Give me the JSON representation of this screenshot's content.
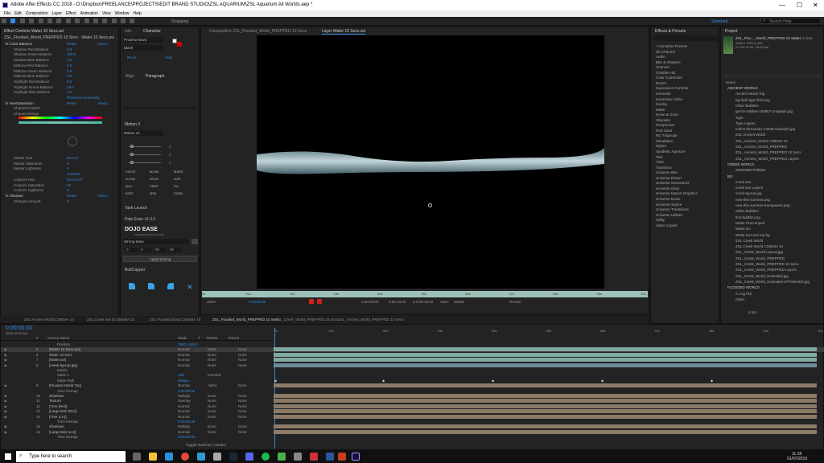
{
  "window": {
    "title": "Adobe After Effects CC 2018 - D:\\Dropbox\\FREELANCE\\PROJECTS\\EDIT BRAND STUDIO\\ZSL AQUARIUM\\ZSL Aquarium All Worlds.aep *",
    "minimize": "—",
    "maximize": "☐",
    "close": "✕"
  },
  "menu": [
    "File",
    "Edit",
    "Composition",
    "Layer",
    "Effect",
    "Animation",
    "View",
    "Window",
    "Help"
  ],
  "toolbar": {
    "snapping": "Snapping",
    "workspace": "Standard",
    "search": "Search Help"
  },
  "effect_controls": {
    "tab": "Effect Controls Water 10 Secs.avi",
    "sub": "ZSL_Flooded_World_PREPPED 10 Secs · Water 10 Secs.avi",
    "rows": [
      {
        "l": "fx Color Balance",
        "v": "Reset",
        "v2": "About..."
      },
      {
        "l": "Shadow Red Balance",
        "v": "0.0"
      },
      {
        "l": "Shadow Green Balance",
        "v": "100.0"
      },
      {
        "l": "Shadow Blue Balance",
        "v": "0.0"
      },
      {
        "l": "Midtone Red Balance",
        "v": "0.0"
      },
      {
        "l": "Midtone Green Balance",
        "v": "0.0"
      },
      {
        "l": "Midtone Blue Balance",
        "v": "0.0"
      },
      {
        "l": "Highlight Red Balance",
        "v": "0.0"
      },
      {
        "l": "Highlight Green Balance",
        "v": "18.0"
      },
      {
        "l": "Highlight Blue Balance",
        "v": "0.0"
      },
      {
        "l": "",
        "v": "Preserve Luminosity"
      },
      {
        "l": "fx Hue/Saturation",
        "v": "Reset",
        "v2": "About..."
      },
      {
        "l": "Channel Control",
        "v": ""
      },
      {
        "l": "Channel Range",
        "v": ""
      }
    ],
    "rows2": [
      {
        "l": "Master Hue",
        "v": "0x+0.0°"
      },
      {
        "l": "Master Saturation",
        "v": "0"
      },
      {
        "l": "Master Lightness",
        "v": "0"
      },
      {
        "l": "",
        "v": "Colorize"
      },
      {
        "l": "Colorize Hue",
        "v": "0x+170.0°"
      },
      {
        "l": "Colorize Saturation",
        "v": "22"
      },
      {
        "l": "Colorize Lightness",
        "v": "0"
      },
      {
        "l": "fx Sharpen",
        "v": "Reset",
        "v2": "About..."
      },
      {
        "l": "Sharpen Amount",
        "v": "0"
      }
    ]
  },
  "info_panel": {
    "tab1": "Info",
    "tab2": "Character",
    "font": "Proxima Nova",
    "style": "Black",
    "size": "80 px",
    "leading": "Auto",
    "tab3": "Align",
    "tab4": "Paragraph",
    "motion": "Motion 2",
    "motion_sel": "Motion v2",
    "motion_vals": [
      "0",
      "0",
      "0"
    ],
    "motion_btns": [
      "EXCITE",
      "BLEND",
      "BURST",
      "CLONE",
      "DELAY",
      "DUPL",
      "NULL",
      "ORBIT",
      "PIN",
      "SORT",
      "SPIN",
      "STARE"
    ],
    "task": "Task Launch",
    "dojo": "Dojo Ease v1.3.2",
    "dojo_logo": "DOJO EASE",
    "dojo_sub": "CREATED BY DOJO LABS",
    "dojo_select": "Strong Ease",
    "dojo_vals": [
      "0",
      "0",
      "90",
      "90"
    ],
    "apply": "Apply Easing",
    "buttcapper": "ButtCapper"
  },
  "viewer": {
    "tab1": "Composition ZSL_Flooded_World_PREPPED 10 Secs",
    "tab2": "Layer Water 10 Secs.avi",
    "zoom": "100%",
    "time": "0:00:00:00",
    "t2": "0:00:00:00",
    "t3": "0:00:10:00",
    "t4": "Δ 0:00:10:02",
    "view": "View:",
    "masks": "Masks",
    "render": "Render",
    "ruler": [
      "0s",
      "01s",
      "02s",
      "03s",
      "04s",
      "05s",
      "06s",
      "07s",
      "08s",
      "09s",
      "10s"
    ]
  },
  "effects_presets": {
    "tab": "Effects & Presets",
    "items": [
      "* Animation Presets",
      "3D Channel",
      "Audio",
      "Blur & Sharpen",
      "Channel",
      "CINEMA 4D",
      "Color Correction",
      "Distort",
      "Expression Controls",
      "Generate",
      "Immersive Video",
      "Keying",
      "Matte",
      "Noise & Grain",
      "Obsolete",
      "Perspective",
      "Red Giant",
      "RG Trapcode",
      "Simulation",
      "Stylize",
      "Synthetic Aperture",
      "Text",
      "Time",
      "Transition",
      "Universe Blur",
      "Universe Distort",
      "Universe Generators",
      "Universe Glow",
      "Universe Motion Graphics",
      "Universe Noise",
      "Universe Stylize",
      "Universe Transitions",
      "Universe Utilities",
      "Utility",
      "Video Copilot"
    ]
  },
  "project": {
    "tab": "Project",
    "comp": "ZSL_Floo..._World_PREPPED 10 Secs",
    "used": ", used 1 time",
    "info": "1080 x 1920 (1.00)",
    "dur": "Δ 0:00:10:00, 25.00 fps",
    "col_name": "Name",
    "items": [
      "ANCIENT WORLD",
      "Ancient World Top",
      "bg-dark-tiger-fish.png",
      "Other Bubbles",
      "gerlov-mikkes-100907-unsplash.jpg",
      "Type",
      "Type Layers",
      "carlos-fernandez-24949-unsplash.jpg",
      "ZSL Ancient World",
      "ZSL_Ancient_World CINEMA 10",
      "ZSL_Ancient_World_PREPPED",
      "ZSL_Ancient_World_PREPPED 10 Secs",
      "ZSL_Ancient_World_PREPPED Layers",
      "CREEK WORLD",
      "20487596 Pebbles",
      "BG",
      "creek text",
      "creek text Layers",
      "creek-bg-top.jpg",
      "new-this-summer.png",
      "new-this-summer-transparent.png",
      "Other Bubbles",
      "this-bubble.png",
      "Water Precomped",
      "Water.avi",
      "White text and top bg",
      "ZSL Creek World",
      "ZSL Creek World CINEMA 10",
      "ZSL_Creek_World Layout.jpg",
      "ZSL_Creek_World_PREPPED",
      "ZSL_Creek_World_PREPPED 10 Secs",
      "ZSL_Creek_World_PREPPED Layers",
      "ZSL_Creek_World_Extended.jpg",
      "ZSL_Creek_World_Extended-OPTIMISED.jpg",
      "FLOODED WORLD",
      "2 x tig fish",
      "Other"
    ],
    "bpc": "8 bpc"
  },
  "comp_tabs": [
    "ZSL Ancient World CINEMA 10",
    "ZSL Creek World CINEMA 10",
    "ZSL Flooded World CINEMA 10",
    "ZSL_Flooded_World_PREPPED 10 Secs",
    "ZSL_Creek_World_PREPPED 10 Secs",
    "ZSL_Ancient_World_PREPPED 10 Secs"
  ],
  "timeline": {
    "timecode": "0:00:00:00",
    "frames": "00000 (25.00 fps)",
    "hdr": {
      "num": "#",
      "name": "Source Name",
      "mode": "Mode",
      "t": "T",
      "trkmat": "TrkMat",
      "parent": "Parent"
    },
    "ruler": [
      "0s",
      "01s",
      "02s",
      "03s",
      "04s",
      "05s",
      "06s",
      "07s",
      "08s",
      "09s",
      "10s"
    ],
    "rows": [
      {
        "n": "",
        "name": "Position",
        "mode": "1920,1080,0",
        "trk": "",
        "par": ""
      },
      {
        "n": "5",
        "name": "[Water 10 Secs.avi]",
        "mode": "Normal",
        "trk": "None",
        "par": "None"
      },
      {
        "n": "6",
        "name": "Water 10 secs",
        "mode": "Normal",
        "trk": "None",
        "par": "None"
      },
      {
        "n": "7",
        "name": "[Water.avi]",
        "mode": "Normal",
        "trk": "None",
        "par": "None"
      },
      {
        "n": "8",
        "name": "[creek-bg-top.jpg]",
        "mode": "Normal",
        "trk": "None",
        "par": "None"
      },
      {
        "n": "",
        "name": "Masks",
        "mode": "",
        "trk": "",
        "par": ""
      },
      {
        "n": "",
        "name": "Mask 1",
        "mode": "Add",
        "trk": "Inverted",
        "par": ""
      },
      {
        "n": "",
        "name": "Mask Path",
        "mode": "Shape...",
        "trk": "",
        "par": ""
      },
      {
        "n": "9",
        "name": "[Flooded World Top]",
        "mode": "Normal",
        "trk": "Alpha",
        "par": "None"
      },
      {
        "n": "",
        "name": "Time Remap",
        "mode": "0:00:00:00",
        "trk": "",
        "par": ""
      },
      {
        "n": "10",
        "name": "Shadows",
        "mode": "Multiply",
        "trk": "None",
        "par": "None"
      },
      {
        "n": "11",
        "name": "Texture",
        "mode": "Overlay",
        "trk": "None",
        "par": "None"
      },
      {
        "n": "12",
        "name": "[Tree (RH)]",
        "mode": "Normal",
        "trk": "None",
        "par": "None"
      },
      {
        "n": "13",
        "name": "[Large Bob (RH)]",
        "mode": "Normal",
        "trk": "None",
        "par": "None"
      },
      {
        "n": "14",
        "name": "[Tree (LH)]",
        "mode": "Normal",
        "trk": "None",
        "par": "None"
      },
      {
        "n": "",
        "name": "Time Remap",
        "mode": "0:00:00:00",
        "trk": "",
        "par": ""
      },
      {
        "n": "15",
        "name": "Shadows",
        "mode": "Multiply",
        "trk": "None",
        "par": "None"
      },
      {
        "n": "16",
        "name": "[Large Bob (LH)]",
        "mode": "Normal",
        "trk": "None",
        "par": "None"
      },
      {
        "n": "",
        "name": "Time Remap",
        "mode": "0:00:00:00",
        "trk": "",
        "par": ""
      }
    ],
    "toggle": "Toggle Switches / Modes"
  },
  "taskbar": {
    "search": "Type here to search",
    "time": "11:18",
    "date": "01/07/2019"
  },
  "colors": {
    "accent": "#2d8ceb",
    "teal_bar": "#7fa9a0",
    "tan_bar": "#8a7a66"
  }
}
